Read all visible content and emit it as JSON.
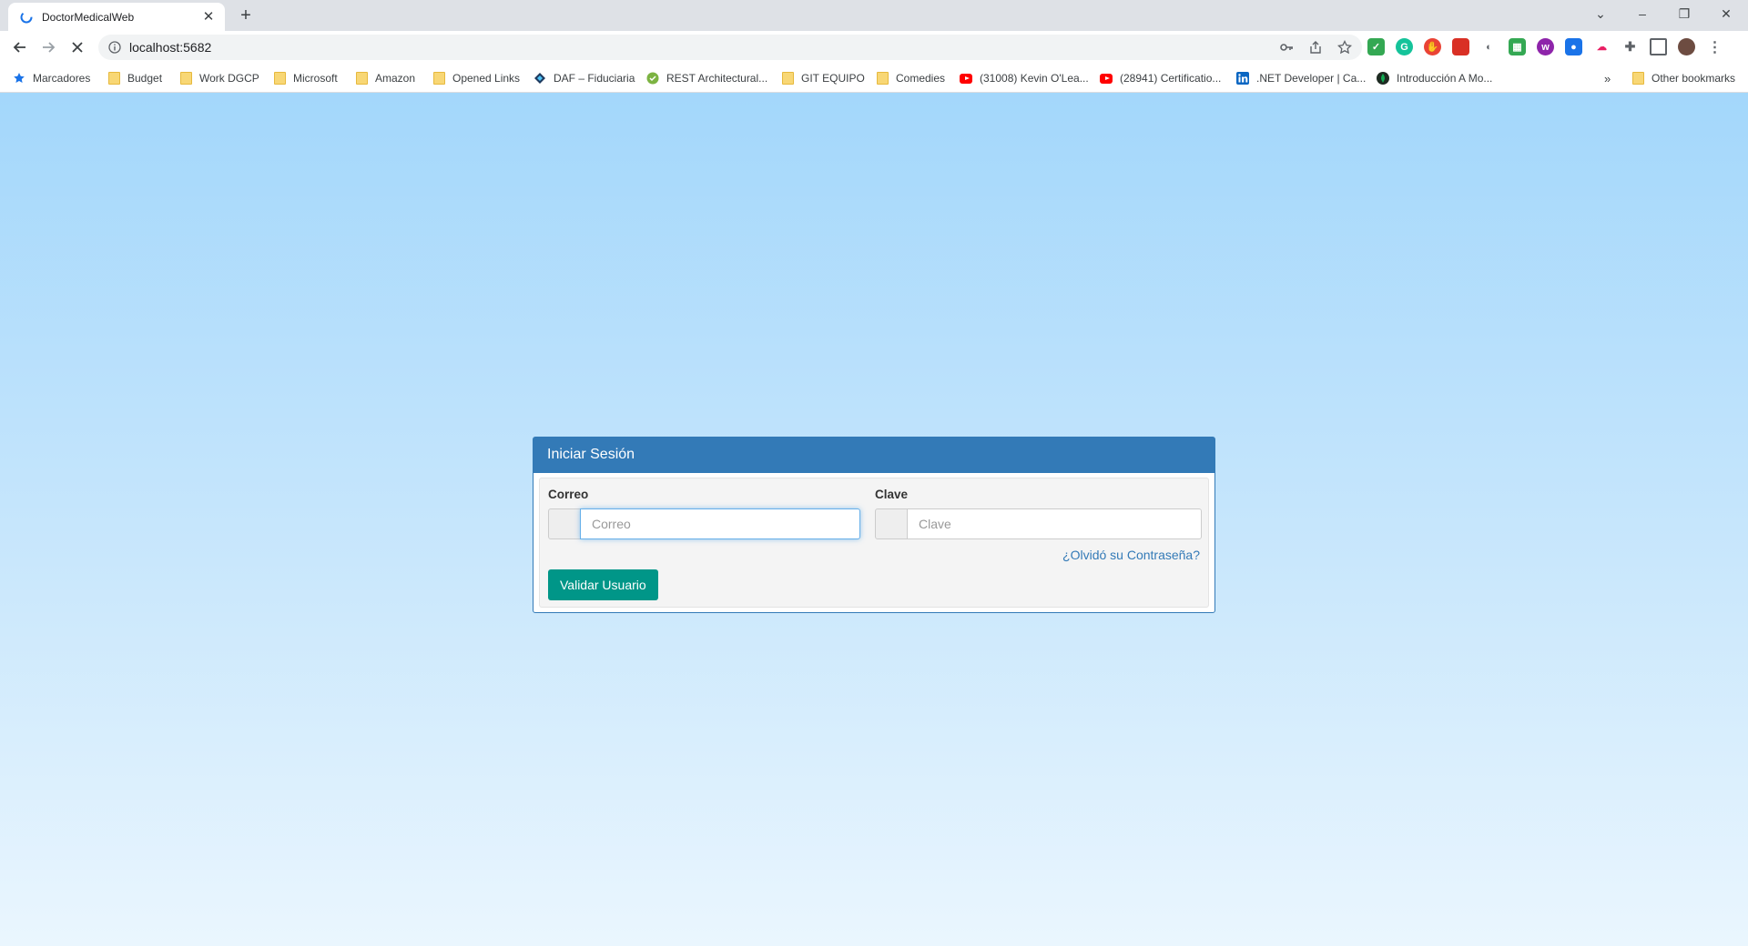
{
  "browser": {
    "tab": {
      "title": "DoctorMedicalWeb",
      "close": "✕"
    },
    "new_tab": "+",
    "window_controls": {
      "list": "⌄",
      "minimize": "–",
      "restore": "❐",
      "close": "✕"
    },
    "address": {
      "url": "localhost:5682"
    },
    "bookmarks": [
      {
        "label": "Marcadores",
        "icon": "star-icon"
      },
      {
        "label": "Budget",
        "icon": "folder-icon"
      },
      {
        "label": "Work DGCP",
        "icon": "folder-icon"
      },
      {
        "label": "Microsoft",
        "icon": "folder-icon"
      },
      {
        "label": "Amazon",
        "icon": "folder-icon"
      },
      {
        "label": "Opened Links",
        "icon": "folder-icon"
      },
      {
        "label": "DAF – Fiduciaria",
        "icon": "site-icon"
      },
      {
        "label": "REST Architectural...",
        "icon": "site-icon"
      },
      {
        "label": "GIT EQUIPO",
        "icon": "folder-icon"
      },
      {
        "label": "Comedies",
        "icon": "folder-icon"
      },
      {
        "label": "(31008) Kevin O'Lea...",
        "icon": "youtube-icon"
      },
      {
        "label": "(28941) Certificatio...",
        "icon": "youtube-icon"
      },
      {
        "label": ".NET Developer | Ca...",
        "icon": "linkedin-icon"
      },
      {
        "label": "Introducción A Mo...",
        "icon": "mongodb-icon"
      }
    ],
    "more_bookmarks": "»",
    "other_bookmarks": "Other bookmarks"
  },
  "login": {
    "title": "Iniciar Sesión",
    "email_label": "Correo",
    "email_placeholder": "Correo",
    "password_label": "Clave",
    "password_placeholder": "Clave",
    "forgot_link": "¿Olvidó su Contraseña?",
    "submit": "Validar Usuario"
  },
  "colors": {
    "panel_primary": "#337ab7",
    "button": "#009688",
    "page_gradient_top": "#a3d7fb",
    "page_gradient_bottom": "#eaf6fe"
  }
}
